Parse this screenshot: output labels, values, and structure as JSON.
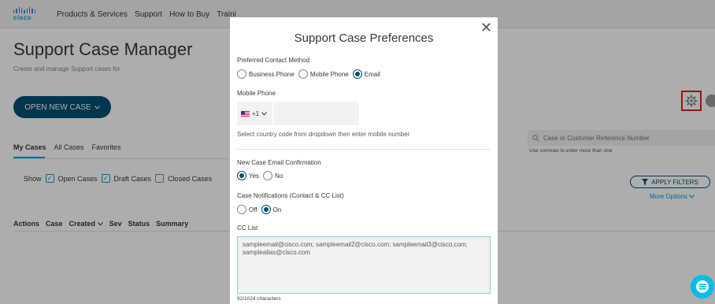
{
  "nav": {
    "logo_text": "cisco",
    "links": [
      "Products & Services",
      "Support",
      "How to Buy",
      "Traini"
    ]
  },
  "page": {
    "title": "Support Case Manager",
    "subtitle": "Create and manage Support cases for",
    "open_case_label": "OPEN NEW CASE",
    "search_placeholder": "Case or Customer Reference Number",
    "search_hint": "Use commas to enter more than one",
    "tabs": [
      "My Cases",
      "All Cases",
      "Favorites"
    ],
    "show_label": "Show",
    "filters": [
      {
        "label": "Open Cases",
        "checked": true
      },
      {
        "label": "Draft Cases",
        "checked": true
      },
      {
        "label": "Closed Cases",
        "checked": false
      }
    ],
    "apply_filters_label": "APPLY FILTERS",
    "more_options_label": "More Options",
    "table_headers": [
      "Actions",
      "Case",
      "Created",
      "Sev",
      "Status",
      "Summary"
    ]
  },
  "modal": {
    "title": "Support Case Preferences",
    "close_symbol": "✕",
    "contact_method": {
      "label": "Preferred Contact Method",
      "options": [
        "Business Phone",
        "Mobile Phone",
        "Email"
      ],
      "selected": "Email"
    },
    "mobile_phone": {
      "label": "Mobile Phone",
      "country_code": "+1",
      "value": "",
      "help": "Select country code from dropdown then enter mobile number"
    },
    "email_confirmation": {
      "label": "New Case Email Confirmation",
      "options": [
        "Yes",
        "No"
      ],
      "selected": "Yes"
    },
    "notifications": {
      "label": "Case Notifications (Contact & CC List)",
      "options": [
        "Off",
        "On"
      ],
      "selected": "On"
    },
    "cc_list": {
      "label": "CC List",
      "value": "sampleemail@cisco.com; sampleemail2@cisco.com; sampleemail3@cisco.com; samplealias@cisco.com",
      "char_count": "92/1024 characters"
    }
  },
  "colors": {
    "brand": "#049fd9",
    "primary_button": "#005073",
    "highlight_box": "#e01e1e",
    "chat_button": "#00bceb"
  }
}
